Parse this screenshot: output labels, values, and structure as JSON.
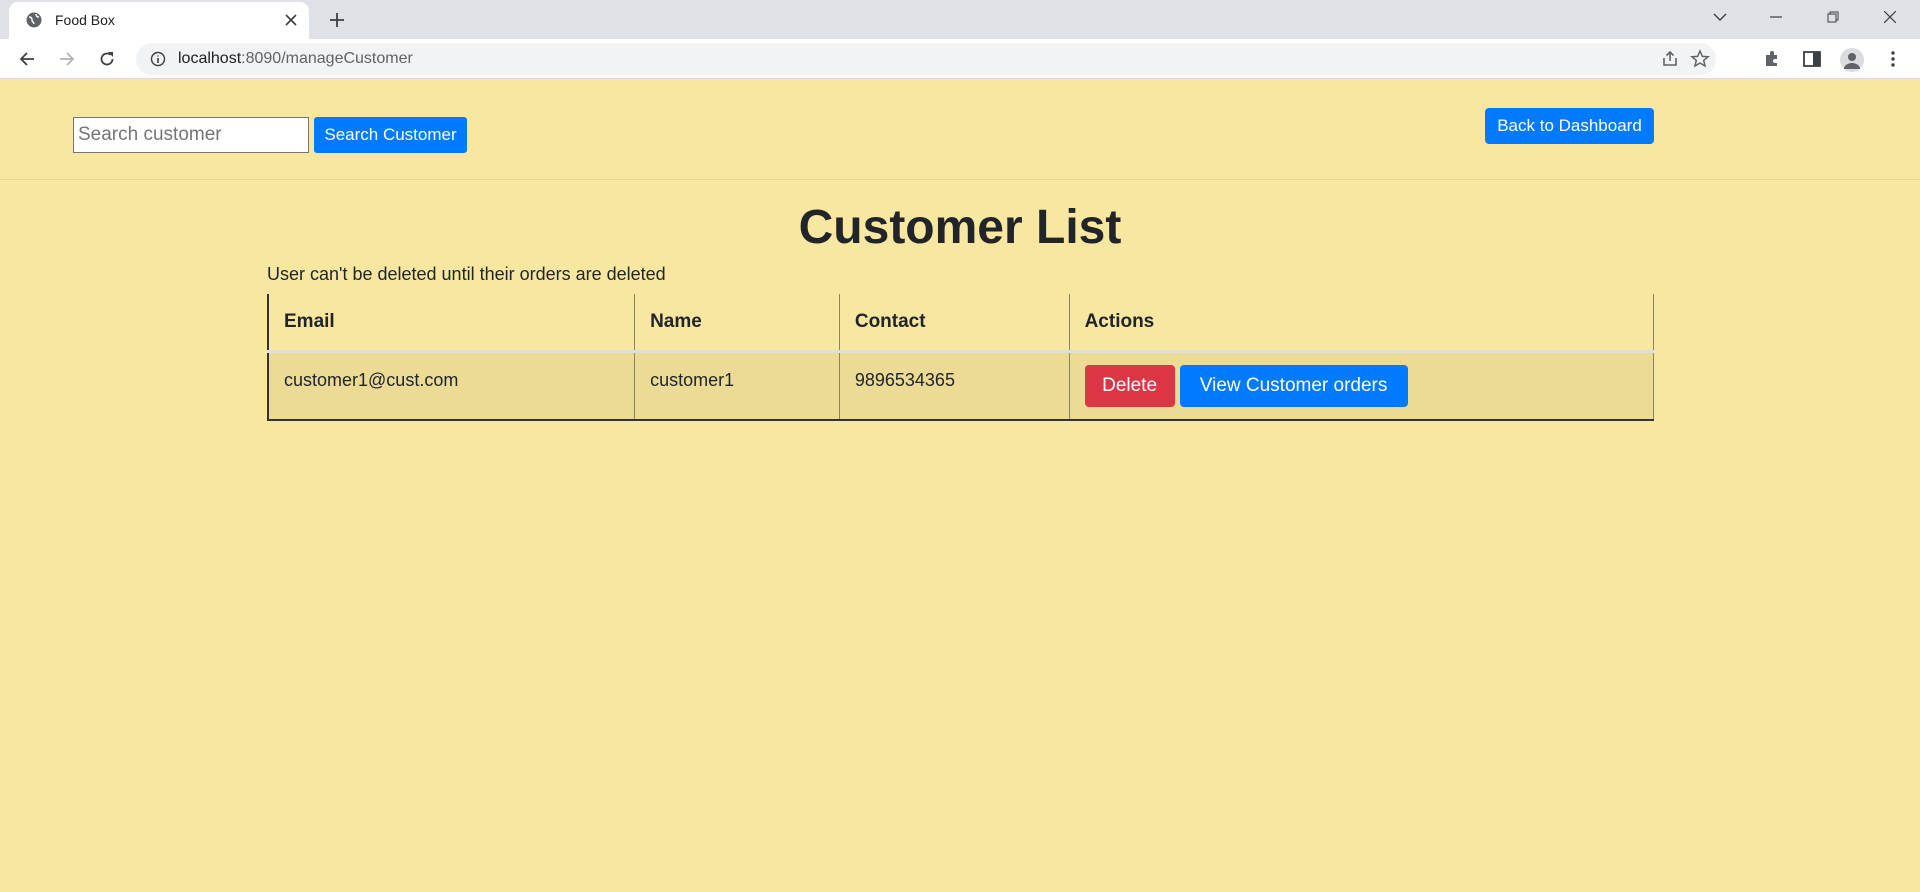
{
  "browser": {
    "tab_title": "Food Box",
    "url_host": "localhost",
    "url_path": ":8090/manageCustomer"
  },
  "topbar": {
    "search_placeholder": "Search customer",
    "search_button": "Search Customer",
    "back_button": "Back to Dashboard"
  },
  "main": {
    "title": "Customer List",
    "note": "User can't be deleted until their orders are deleted",
    "table": {
      "headers": [
        "Email",
        "Name",
        "Contact",
        "Actions"
      ],
      "rows": [
        {
          "email": "customer1@cust.com",
          "name": "customer1",
          "contact": "9896534365",
          "delete_label": "Delete",
          "view_orders_label": "View Customer orders"
        }
      ]
    }
  },
  "colors": {
    "page_background": "#f7e7a0",
    "primary": "#007bff",
    "danger": "#dc3545",
    "row_background": "#ecdb95"
  }
}
